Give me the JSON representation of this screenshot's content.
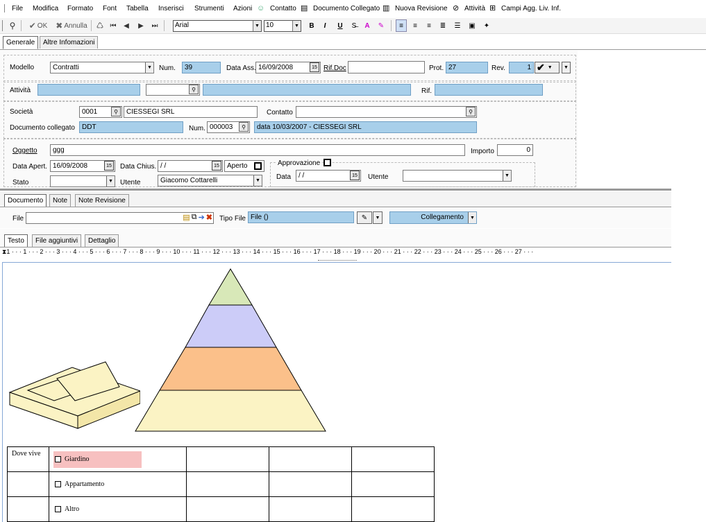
{
  "menu": {
    "items": [
      "File",
      "Modifica",
      "Formato",
      "Font",
      "Tabella",
      "Inserisci",
      "Strumenti",
      "Azioni",
      "Contatto",
      "Documento Collegato",
      "Nuova Revisione",
      "Attività",
      "Campi Agg. Liv. Inf."
    ]
  },
  "toolbar": {
    "ok_label": "OK",
    "cancel_label": "Annulla",
    "font_family": "Arial",
    "font_size": "10",
    "bold": "B",
    "italic": "I",
    "underline": "U"
  },
  "tabs_top": [
    "Generale",
    "Altre Infomazioni"
  ],
  "form": {
    "modello_label": "Modello",
    "modello_value": "Contratti",
    "num_label": "Num.",
    "num_value": "39",
    "data_ass_label": "Data Ass.",
    "data_ass_value": "16/09/2008",
    "rif_doc_label": "Rif.Doc",
    "rif_doc_value": "",
    "prot_label": "Prot.",
    "prot_value": "27",
    "rev_label": "Rev.",
    "rev_value": "1",
    "attivita_label": "Attività",
    "rif_label": "Rif.",
    "societa_label": "Società",
    "societa_code": "0001",
    "societa_name": "CIESSEGI SRL",
    "contatto_label": "Contatto",
    "doc_coll_label": "Documento collegato",
    "doc_coll_value": "DDT",
    "doc_num_label": "Num.",
    "doc_num_value": "000003",
    "doc_desc": "data 10/03/2007 - CIESSEGI SRL",
    "oggetto_label": "Oggetto",
    "oggetto_value": "ggg",
    "importo_label": "Importo",
    "importo_value": "0",
    "data_apert_label": "Data Apert.",
    "data_apert_value": "16/09/2008",
    "data_chius_label": "Data Chius.",
    "data_chius_value": " / /",
    "aperto_label": "Aperto",
    "approvazione_label": "Approvazione",
    "data_label": "Data",
    "data_value": " / /",
    "utente_label": "Utente",
    "utente_value": "Giacomo Cottarelli",
    "utente2_label": "Utente",
    "stato_label": "Stato"
  },
  "tabs_doc": [
    "Documento",
    "Note",
    "Note Revisione"
  ],
  "file_row": {
    "file_label": "File",
    "tipo_file_label": "Tipo File",
    "tipo_file_value": "File  ()",
    "collegamento_label": "Collegamento"
  },
  "tabs_editor": [
    "Testo",
    "File aggiuntivi",
    "Dettaglio"
  ],
  "ruler_text": "1 · · · 1 · · · 2 · · · 3 · · · 4 · · · 5 · · · 6 · · · 7 · · · 8 · · · 9 · · · 10 · · · 11 · · · 12 · · · 13 · · · 14 · · · 15 · · · 16 · · · 17 · · · 18 · · · 19 · · · 20 · · · 21 · · · 22 · · · 23 · · · 24 · · · 25 · · · 26 · · · 27 · · ·",
  "table": {
    "row1_label": "Dove vive",
    "options": [
      "Giardino",
      "Appartamento",
      "Altro"
    ]
  },
  "colors": {
    "blue_field": "#a8cfea",
    "pyramid": [
      "#d8e8b8",
      "#ccccf8",
      "#fbc08a",
      "#fbf3c4"
    ],
    "highlight": "#f7c0c0"
  }
}
